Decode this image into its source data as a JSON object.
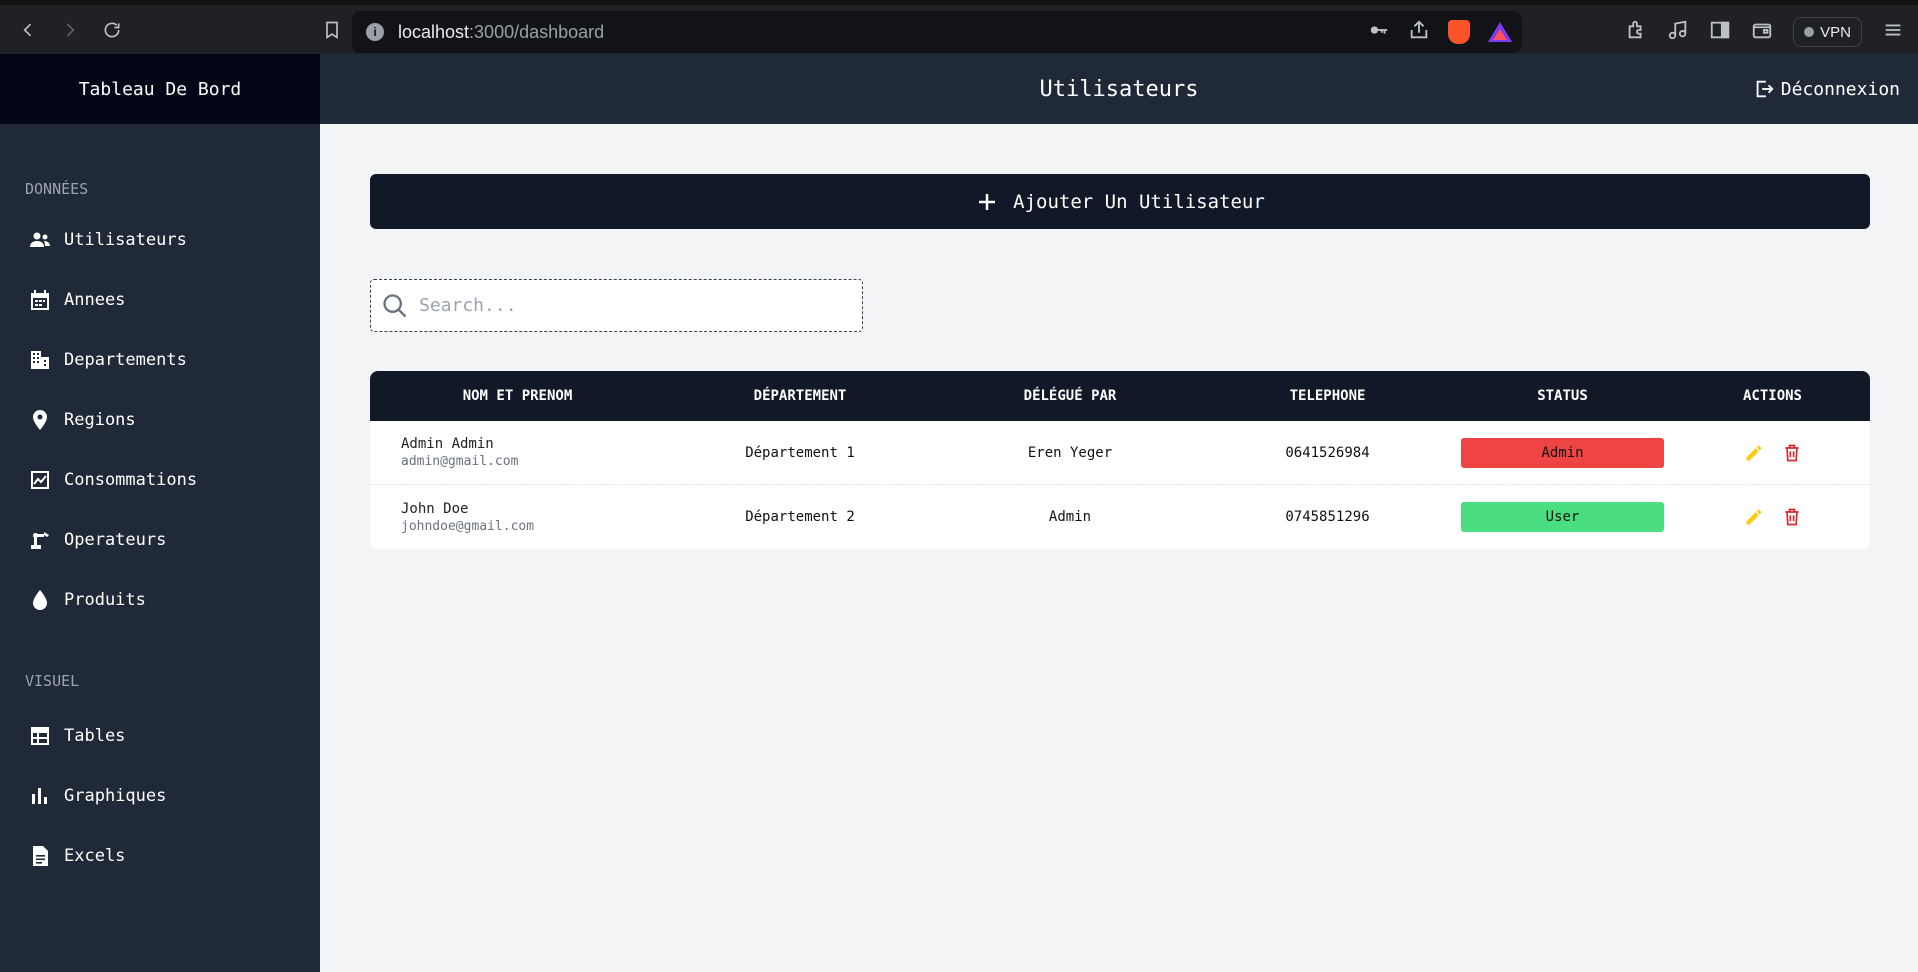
{
  "browser": {
    "url_host": "localhost",
    "url_path": ":3000/dashboard",
    "vpn_label": "VPN"
  },
  "sidebar": {
    "title": "Tableau De Bord",
    "sections": [
      {
        "label": "DONNÉES",
        "items": [
          {
            "label": "Utilisateurs",
            "icon": "users-icon"
          },
          {
            "label": "Annees",
            "icon": "calendar-icon"
          },
          {
            "label": "Departements",
            "icon": "building-icon"
          },
          {
            "label": "Regions",
            "icon": "location-pin-icon"
          },
          {
            "label": "Consommations",
            "icon": "chart-line-icon"
          },
          {
            "label": "Operateurs",
            "icon": "operator-icon"
          },
          {
            "label": "Produits",
            "icon": "drop-icon"
          }
        ]
      },
      {
        "label": "VISUEL",
        "items": [
          {
            "label": "Tables",
            "icon": "table-icon"
          },
          {
            "label": "Graphiques",
            "icon": "bar-chart-icon"
          },
          {
            "label": "Excels",
            "icon": "document-icon"
          }
        ]
      }
    ]
  },
  "header": {
    "title": "Utilisateurs",
    "logout_label": "Déconnexion"
  },
  "main": {
    "add_button_label": "Ajouter Un Utilisateur",
    "search_placeholder": "Search...",
    "table": {
      "headers": [
        "NOM ET PRENOM",
        "DÉPARTEMENT",
        "DÉLÉGUÉ PAR",
        "TELEPHONE",
        "STATUS",
        "ACTIONS"
      ],
      "rows": [
        {
          "name": "Admin Admin",
          "email": "admin@gmail.com",
          "department": "Département 1",
          "delegated_by": "Eren Yeger",
          "phone": "0641526984",
          "status": "Admin",
          "status_color": "#ef4444"
        },
        {
          "name": "John Doe",
          "email": "johndoe@gmail.com",
          "department": "Département 2",
          "delegated_by": "Admin",
          "phone": "0745851296",
          "status": "User",
          "status_color": "#4ade80"
        }
      ]
    }
  },
  "colors": {
    "edit_icon": "#facc15",
    "delete_icon": "#dc2626"
  }
}
